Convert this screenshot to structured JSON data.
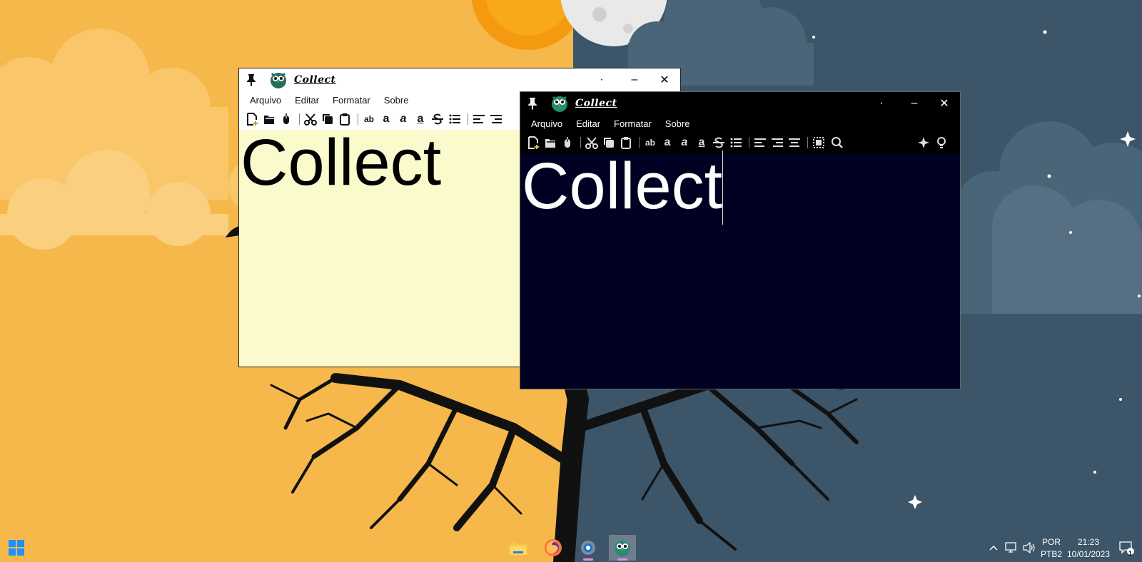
{
  "windows": [
    {
      "id": "light",
      "title": "Collect",
      "menu": [
        "Arquivo",
        "Editar",
        "Formatar",
        "Sobre"
      ],
      "content": "Collect",
      "buttons": {
        "dot": "·",
        "minimize": "–",
        "close": "✕"
      }
    },
    {
      "id": "dark",
      "title": "Collect",
      "menu": [
        "Arquivo",
        "Editar",
        "Formatar",
        "Sobre"
      ],
      "content": "Collect",
      "buttons": {
        "dot": "·",
        "minimize": "–",
        "close": "✕"
      }
    }
  ],
  "toolbar_icons": [
    "new-file-icon",
    "open-file-icon",
    "mouse-icon",
    "cut-icon",
    "copy-icon",
    "paste-icon",
    "strikethrough-ab-icon",
    "bold-icon",
    "italic-icon",
    "underline-icon",
    "strikethrough-icon",
    "list-icon",
    "align-left-icon",
    "align-right-icon",
    "align-center-icon",
    "select-all-icon",
    "search-icon",
    "sparkle-icon",
    "lightbulb-icon"
  ],
  "taskbar": {
    "apps": [
      "start-icon",
      "file-explorer-icon",
      "firefox-icon",
      "settings-icon",
      "collect-app-icon"
    ],
    "language": "POR",
    "keyboard": "PTB2",
    "time": "21:23",
    "date": "10/01/2023",
    "notifications": "1"
  },
  "colors": {
    "light_editor_bg": "#fafacd",
    "dark_editor_bg": "#000022",
    "taskbar_indicator": "#e88be6"
  }
}
